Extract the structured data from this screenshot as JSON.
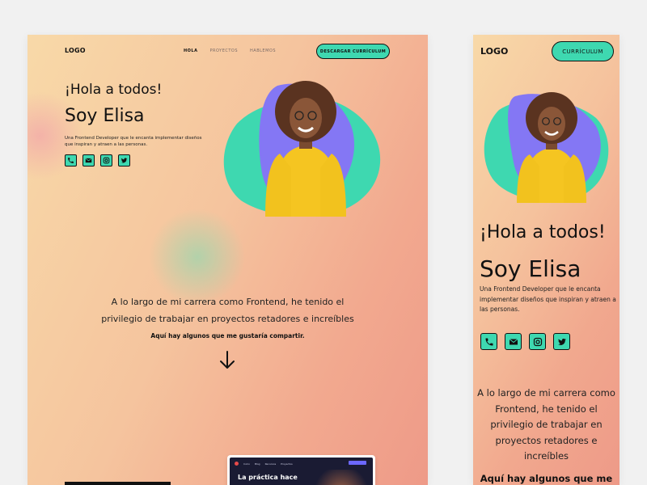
{
  "desktop": {
    "logo": "LOGO",
    "nav": [
      {
        "label": "HOLA"
      },
      {
        "label": "PROYECTOS"
      },
      {
        "label": "HABLEMOS"
      }
    ],
    "cv_button": "DESCARGAR CURRÍCULUM",
    "greeting": "¡Hola a todos!",
    "name": "Soy Elisa",
    "description": "Una Frontend Developer que le encanta implementar diseños que inspiran y atraen a las personas.",
    "career_text": "A lo largo de mi carrera como Frontend, he tenido el privilegio de trabajar en proyectos retadores e increíbles",
    "share_text": "Aquí hay algunos que me gustaría compartir.",
    "project_card": {
      "title": "La práctica hace",
      "nav": [
        "Inicio",
        "Blog",
        "Recursos",
        "Proyectos"
      ]
    }
  },
  "mobile": {
    "logo": "LOGO",
    "cv_button": "CURRÍCULUM",
    "greeting": "¡Hola a todos!",
    "name": "Soy Elisa",
    "description": "Una Frontend Developer que le encanta implementar diseños que inspiran y atraen a las personas.",
    "career_text": "A lo largo de mi carrera como Frontend, he tenido el privilegio de trabajar en proyectos retadores e increíbles",
    "share_text": "Aquí hay algunos que me"
  },
  "socials": [
    {
      "icon": "phone-icon",
      "glyph": "✆"
    },
    {
      "icon": "mail-icon",
      "glyph": "✉"
    },
    {
      "icon": "instagram-icon",
      "glyph": "◎"
    },
    {
      "icon": "twitter-icon",
      "glyph": "🐦"
    }
  ],
  "colors": {
    "accent": "#3ed8b0",
    "blob_purple": "#8477f4",
    "shirt": "#f5c521"
  }
}
